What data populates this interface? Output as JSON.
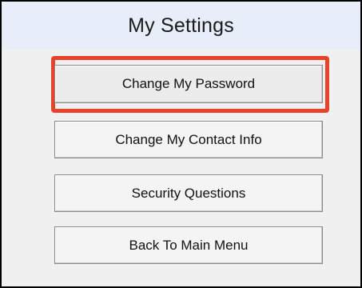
{
  "window": {
    "title": "My Settings"
  },
  "buttons": [
    {
      "label": "Change My Password"
    },
    {
      "label": "Change My Contact Info"
    },
    {
      "label": "Security Questions"
    },
    {
      "label": "Back To Main Menu"
    }
  ],
  "colors": {
    "highlight": "#e8432a",
    "title_bar": "#e8eef9",
    "panel": "#f0f0f0"
  }
}
